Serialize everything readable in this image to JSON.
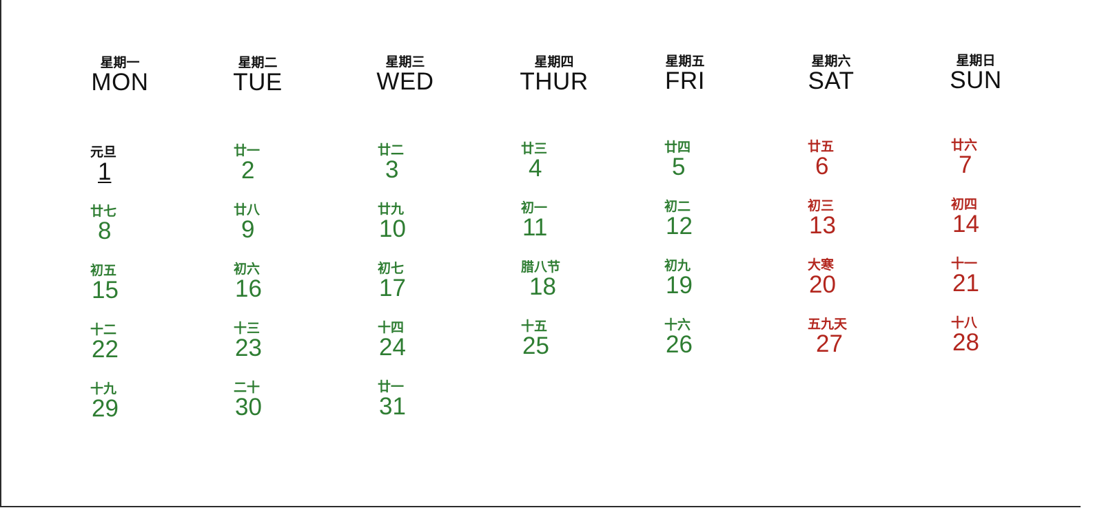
{
  "colors": {
    "weekday": "#2e7d32",
    "weekend": "#b3261e",
    "today": "#111111",
    "header": "#111111"
  },
  "weekdays": [
    {
      "cn": "星期一",
      "en": "MON"
    },
    {
      "cn": "星期二",
      "en": "TUE"
    },
    {
      "cn": "星期三",
      "en": "WED"
    },
    {
      "cn": "星期四",
      "en": "THUR"
    },
    {
      "cn": "星期五",
      "en": "FRI"
    },
    {
      "cn": "星期六",
      "en": "SAT"
    },
    {
      "cn": "星期日",
      "en": "SUN"
    }
  ],
  "days": [
    {
      "day": "1",
      "lunar": "元旦",
      "today": true
    },
    {
      "day": "2",
      "lunar": "廿一"
    },
    {
      "day": "3",
      "lunar": "廿二"
    },
    {
      "day": "4",
      "lunar": "廿三"
    },
    {
      "day": "5",
      "lunar": "廿四"
    },
    {
      "day": "6",
      "lunar": "廿五"
    },
    {
      "day": "7",
      "lunar": "廿六"
    },
    {
      "day": "8",
      "lunar": "廿七"
    },
    {
      "day": "9",
      "lunar": "廿八"
    },
    {
      "day": "10",
      "lunar": "廿九"
    },
    {
      "day": "11",
      "lunar": "初一"
    },
    {
      "day": "12",
      "lunar": "初二"
    },
    {
      "day": "13",
      "lunar": "初三"
    },
    {
      "day": "14",
      "lunar": "初四"
    },
    {
      "day": "15",
      "lunar": "初五"
    },
    {
      "day": "16",
      "lunar": "初六"
    },
    {
      "day": "17",
      "lunar": "初七"
    },
    {
      "day": "18",
      "lunar": "腊八节"
    },
    {
      "day": "19",
      "lunar": "初九"
    },
    {
      "day": "20",
      "lunar": "大寒"
    },
    {
      "day": "21",
      "lunar": "十一"
    },
    {
      "day": "22",
      "lunar": "十二"
    },
    {
      "day": "23",
      "lunar": "十三"
    },
    {
      "day": "24",
      "lunar": "十四"
    },
    {
      "day": "25",
      "lunar": "十五"
    },
    {
      "day": "26",
      "lunar": "十六"
    },
    {
      "day": "27",
      "lunar": "五九天"
    },
    {
      "day": "28",
      "lunar": "十八"
    },
    {
      "day": "29",
      "lunar": "十九"
    },
    {
      "day": "30",
      "lunar": "二十"
    },
    {
      "day": "31",
      "lunar": "廿一"
    }
  ]
}
